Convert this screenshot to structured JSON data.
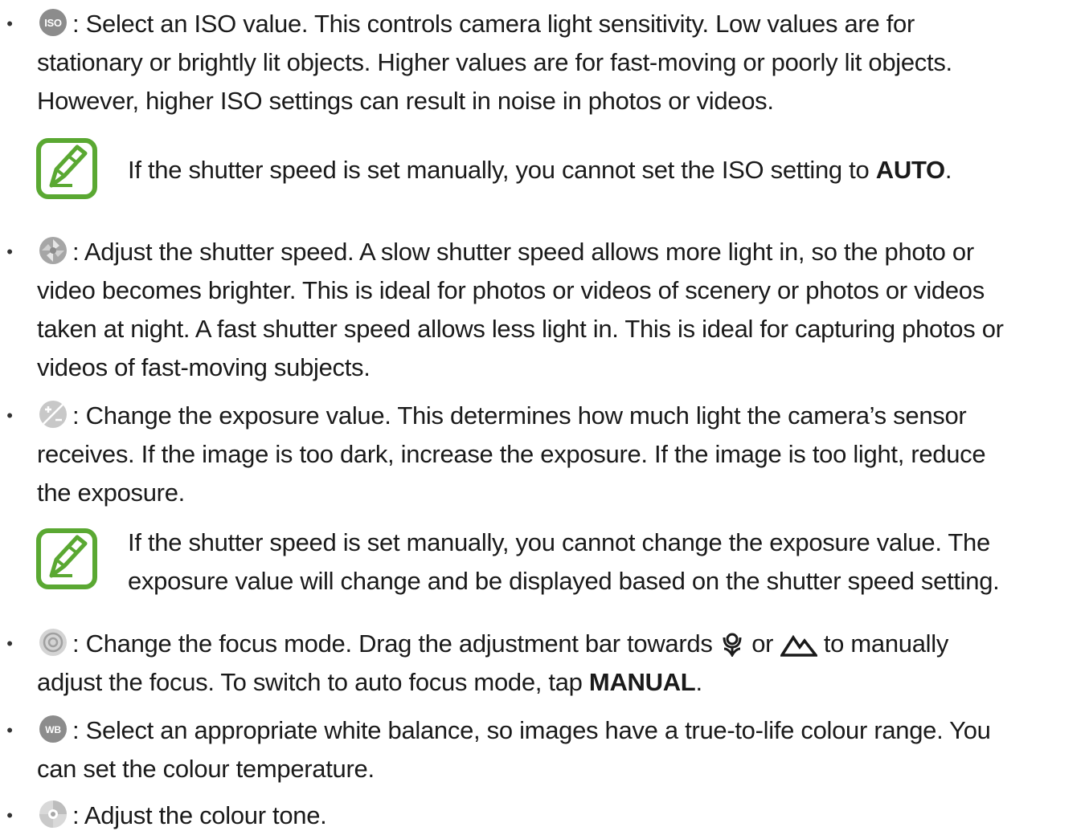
{
  "items": [
    {
      "icon": "iso-icon",
      "lines": [
        ": Select an ISO value. This controls camera light sensitivity. Low values are for",
        "stationary or brightly lit objects. Higher values are for fast-moving or poorly lit objects.",
        "However, higher ISO settings can result in noise in photos or videos."
      ]
    },
    {
      "icon": "shutter-icon",
      "lines": [
        ": Adjust the shutter speed. A slow shutter speed allows more light in, so the photo or",
        "video becomes brighter. This is ideal for photos or videos of scenery or photos or videos",
        "taken at night. A fast shutter speed allows less light in. This is ideal for capturing photos or",
        "videos of fast-moving subjects."
      ]
    },
    {
      "icon": "exposure-icon",
      "lines": [
        ": Change the exposure value. This determines how much light the camera’s sensor",
        "receives. If the image is too dark, increase the exposure. If the image is too light, reduce",
        "the exposure."
      ]
    },
    {
      "icon": "focus-icon",
      "line1_a": ": Change the focus mode. Drag the adjustment bar towards",
      "line1_b": "or",
      "line1_c": "to manually",
      "line2_a": "adjust the focus. To switch to auto focus mode, tap",
      "line2_bold": "MANUAL",
      "line2_end": "."
    },
    {
      "icon": "white-balance-icon",
      "lines": [
        ": Select an appropriate white balance, so images have a true-to-life colour range. You",
        "can set the colour temperature."
      ]
    },
    {
      "icon": "colour-tone-icon",
      "lines": [
        ": Adjust the colour tone."
      ]
    }
  ],
  "notes": [
    {
      "icon": "note-icon",
      "text_a": "If the shutter speed is set manually, you cannot set the ISO setting to",
      "text_bold": "AUTO",
      "text_end": "."
    },
    {
      "icon": "note-icon",
      "lines": [
        "If the shutter speed is set manually, you cannot change the exposure value. The",
        "exposure value will change and be displayed based on the shutter speed setting."
      ]
    }
  ],
  "icon_labels": {
    "iso": "ISO",
    "wb": "WB"
  },
  "colors": {
    "note_green": "#5aa832",
    "icon_grey": "#8c8c8c"
  }
}
